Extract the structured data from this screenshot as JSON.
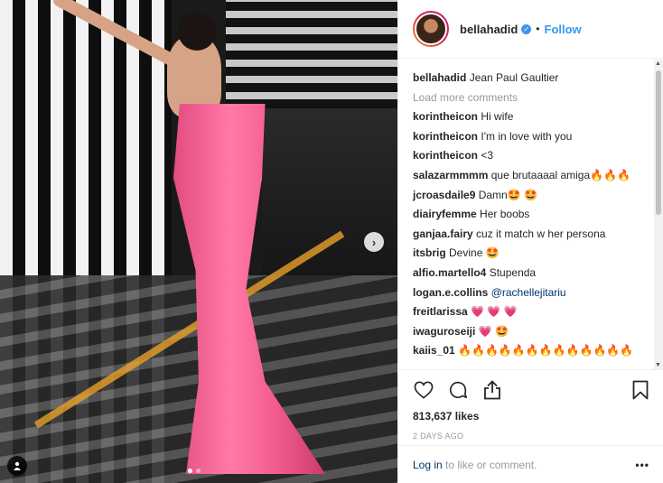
{
  "post": {
    "author": "bellahadid",
    "follow_label": "Follow",
    "separator": "•",
    "caption_user": "bellahadid",
    "caption_text": "Jean Paul Gaultier",
    "load_more": "Load more comments",
    "likes": "813,637 likes",
    "time_ago": "2 DAYS AGO",
    "footer_login": "Log in",
    "footer_rest": " to like or comment.",
    "footer_more": "•••",
    "carousel_count": 2,
    "carousel_active": 1
  },
  "comments": [
    {
      "user": "korintheicon",
      "text": "Hi wife"
    },
    {
      "user": "korintheicon",
      "text": "I'm in love with you"
    },
    {
      "user": "korintheicon",
      "text": "<3"
    },
    {
      "user": "salazarmmmm",
      "text": "que brutaaaal amiga🔥🔥🔥"
    },
    {
      "user": "jcroasdaile9",
      "text": "Damn🤩 🤩"
    },
    {
      "user": "diairyfemme",
      "text": "Her boobs"
    },
    {
      "user": "ganjaa.fairy",
      "text": "cuz it match w her persona"
    },
    {
      "user": "itsbrig",
      "text": "Devine 🤩"
    },
    {
      "user": "alfio.martello4",
      "text": "Stupenda"
    },
    {
      "user": "logan.e.collins",
      "text": "@rachellejitariu"
    },
    {
      "user": "freitlarissa",
      "text": "💗 💗 💗"
    },
    {
      "user": "iwaguroseiji",
      "text": "💗 🤩"
    },
    {
      "user": "kaiis_01",
      "text": "🔥🔥🔥🔥🔥🔥🔥🔥🔥🔥🔥🔥🔥"
    }
  ],
  "icons": {
    "like": "heart-icon",
    "comment": "comment-icon",
    "share": "share-icon",
    "save": "bookmark-icon",
    "verified": "verified-badge-icon",
    "next": "chevron-right-icon",
    "tag": "user-tag-icon"
  },
  "colors": {
    "accent": "#3897f0",
    "text": "#262626",
    "muted": "#999999"
  }
}
